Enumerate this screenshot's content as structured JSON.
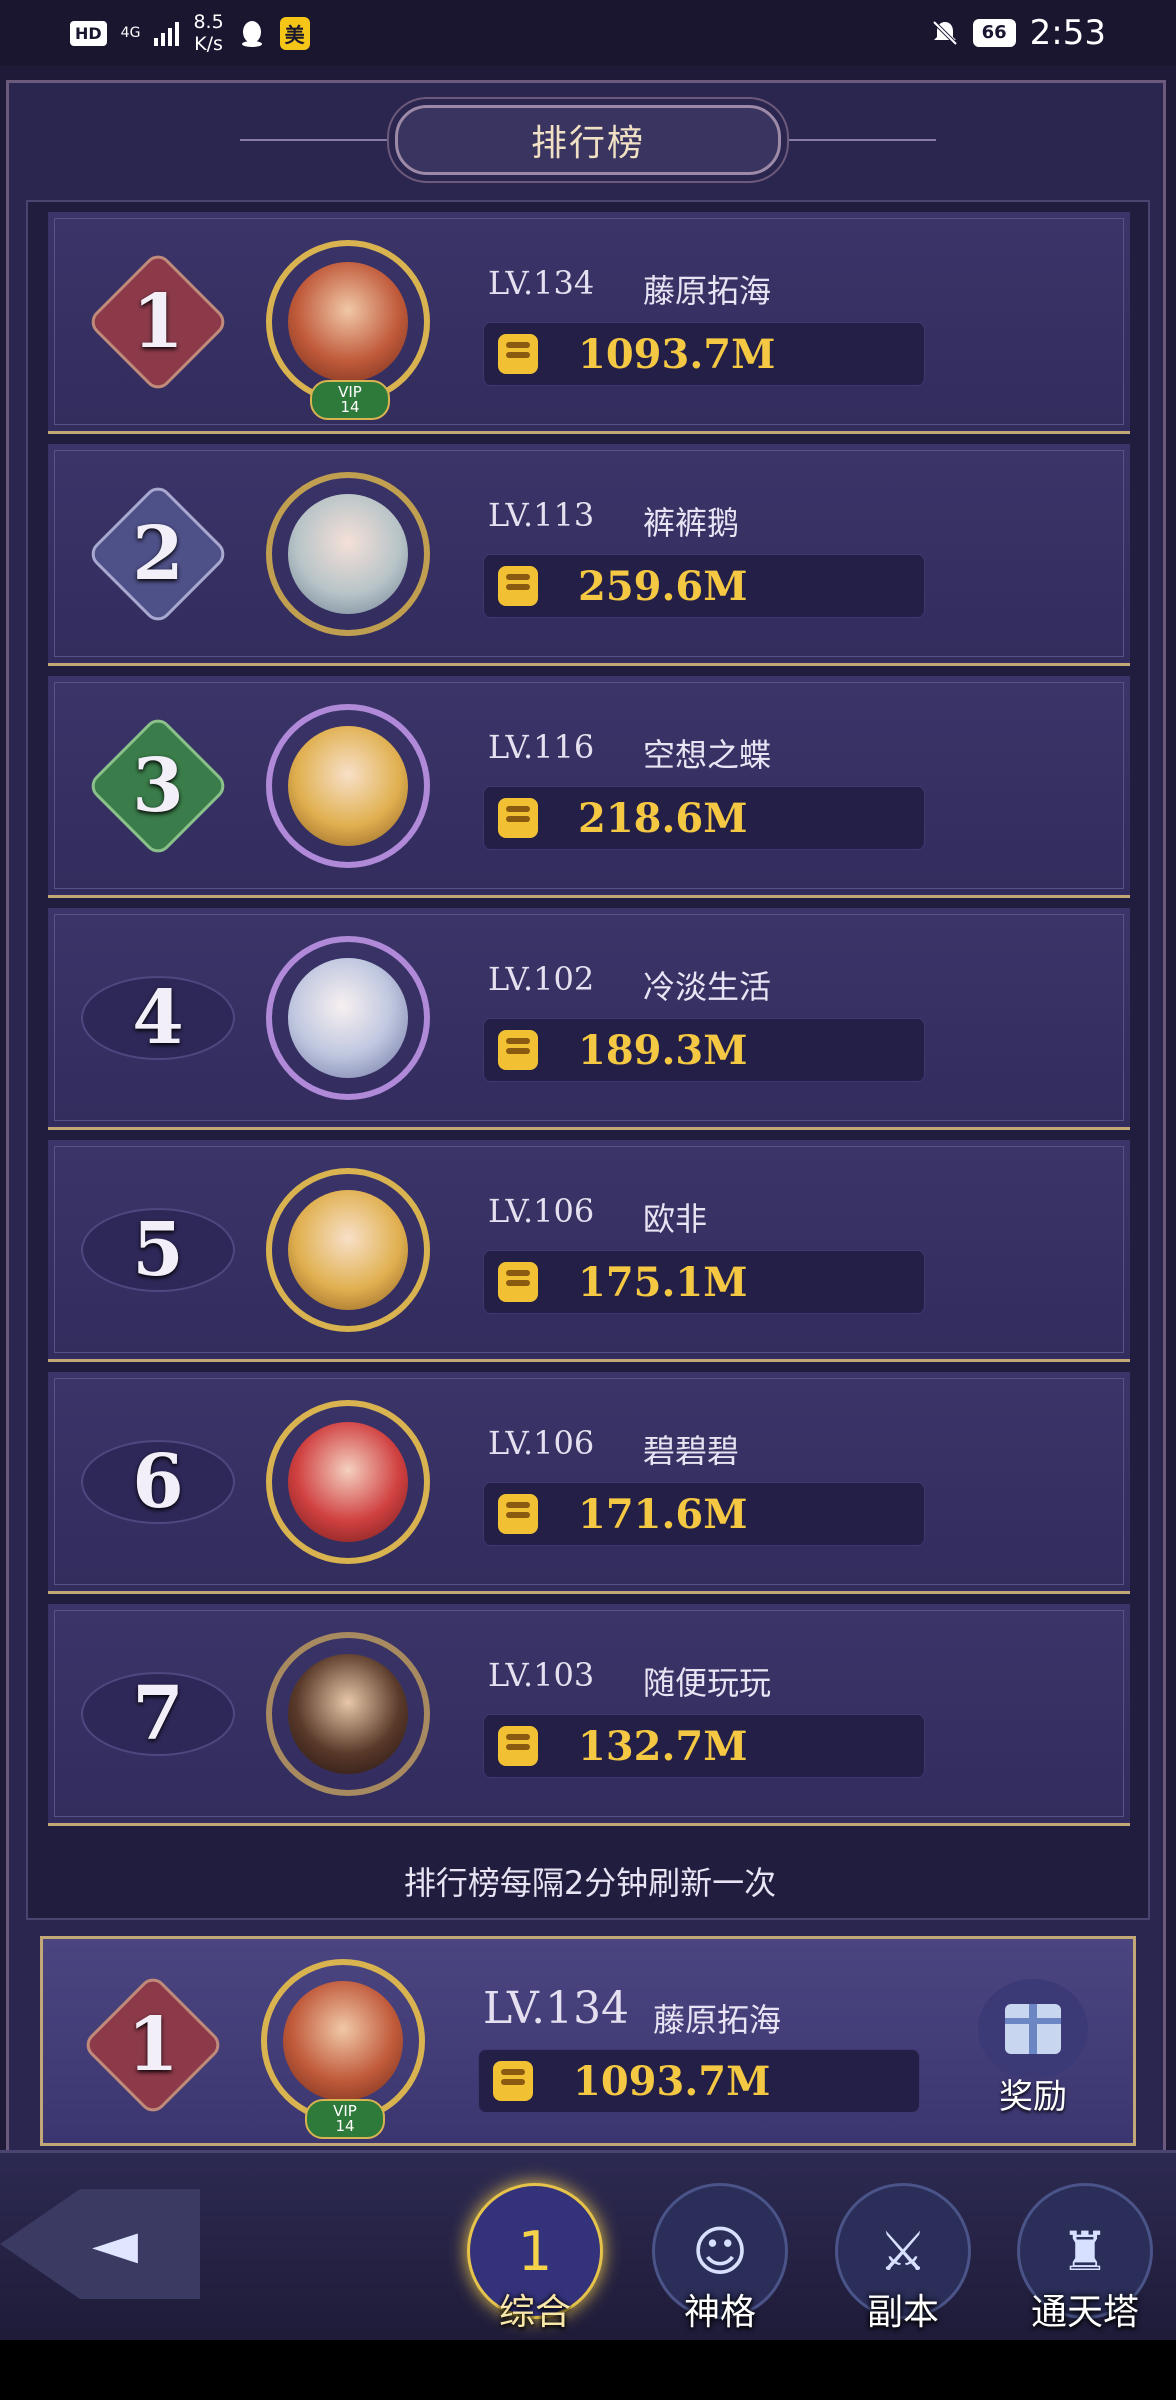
{
  "status_bar": {
    "hd": "HD",
    "network": "4G",
    "speed": "8.5\nK/s",
    "app_badge": "美",
    "battery": "66",
    "time": "2:53"
  },
  "title": "排行榜",
  "rankings": [
    {
      "rank": "1",
      "level": "LV.134",
      "name": "藤原拓海",
      "power": "1093.7M",
      "vip": "VIP",
      "vip_level": "14"
    },
    {
      "rank": "2",
      "level": "LV.113",
      "name": "裤裤鹅",
      "power": "259.6M"
    },
    {
      "rank": "3",
      "level": "LV.116",
      "name": "空想之蝶",
      "power": "218.6M"
    },
    {
      "rank": "4",
      "level": "LV.102",
      "name": "冷淡生活",
      "power": "189.3M"
    },
    {
      "rank": "5",
      "level": "LV.106",
      "name": "欧非",
      "power": "175.1M"
    },
    {
      "rank": "6",
      "level": "LV.106",
      "name": "碧碧碧",
      "power": "171.6M"
    },
    {
      "rank": "7",
      "level": "LV.103",
      "name": "随便玩玩",
      "power": "132.7M"
    }
  ],
  "refresh_note": "排行榜每隔2分钟刷新一次",
  "my_rank": {
    "rank": "1",
    "level": "LV.134",
    "name": "藤原拓海",
    "power": "1093.7M",
    "vip": "VIP",
    "vip_level": "14"
  },
  "reward_label": "奖励",
  "nav": {
    "items": [
      {
        "label": "综合",
        "icon": "1"
      },
      {
        "label": "神格",
        "icon": "☺"
      },
      {
        "label": "副本",
        "icon": "⚔"
      },
      {
        "label": "通天塔",
        "icon": "♜"
      }
    ]
  },
  "colors": {
    "rank1": "#8c3a4a",
    "rank2": "#5a5c90",
    "rank3": "#3a7c4a",
    "gold": "#f4c842",
    "frame": "#c4a777"
  }
}
